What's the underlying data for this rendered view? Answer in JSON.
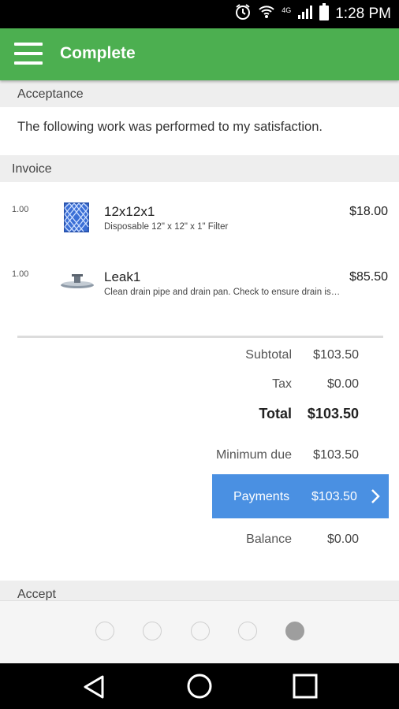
{
  "status_bar": {
    "time": "1:28 PM",
    "network": "4G",
    "icons": [
      "alarm-icon",
      "wifi-icon",
      "signal-icon",
      "battery-icon"
    ]
  },
  "app_bar": {
    "title": "Complete",
    "color": "#4caf50"
  },
  "acceptance": {
    "header": "Acceptance",
    "text": "The following work was performed to my satisfaction."
  },
  "invoice": {
    "header": "Invoice",
    "items": [
      {
        "qty": "1.00",
        "name": "12x12x1",
        "description": "Disposable 12\" x 12\" x 1\" Filter",
        "price": "$18.00",
        "icon": "filter-icon"
      },
      {
        "qty": "1.00",
        "name": "Leak1",
        "description": "Clean drain pipe and drain pan. Check to ensure drain is clear and working properly.",
        "price": "$85.50",
        "icon": "drain-pan-icon"
      }
    ]
  },
  "totals": {
    "subtotal_label": "Subtotal",
    "subtotal": "$103.50",
    "tax_label": "Tax",
    "tax": "$0.00",
    "total_label": "Total",
    "total": "$103.50",
    "minimum_due_label": "Minimum due",
    "minimum_due": "$103.50",
    "balance_label": "Balance",
    "balance": "$0.00"
  },
  "payments_button": {
    "label": "Payments",
    "amount": "$103.50",
    "color": "#4a90e2"
  },
  "accept_section": {
    "header": "Accept"
  },
  "pager": {
    "page_count": 5,
    "current_page": 5
  },
  "nav_bar": {
    "icons": [
      "back-icon",
      "home-icon",
      "recents-icon"
    ]
  }
}
